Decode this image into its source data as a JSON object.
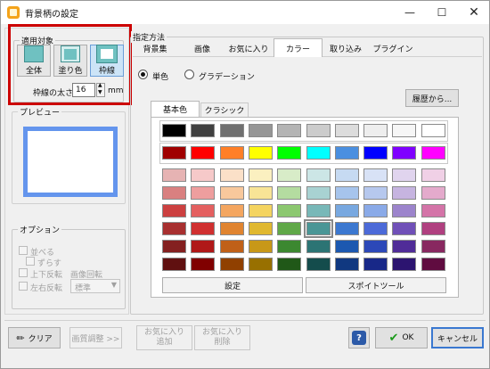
{
  "window": {
    "title": "背景柄の設定"
  },
  "target": {
    "legend": "適用対象",
    "buttons": [
      "全体",
      "塗り色",
      "枠線"
    ],
    "width_label": "枠線の太さ",
    "width_value": "16",
    "width_unit": "mm"
  },
  "preview": {
    "legend": "プレビュー"
  },
  "options": {
    "legend": "オプション",
    "tile": "並べる",
    "shift": "ずらす",
    "flip_v": "上下反転",
    "rotate_label": "画像回転",
    "flip_h": "左右反転",
    "rotate_value": "標準"
  },
  "method": {
    "legend": "指定方法",
    "tabs": [
      "背景集",
      "画像",
      "お気に入り",
      "カラー",
      "取り込み",
      "プラグイン"
    ],
    "active_tab": "カラー",
    "radio_solid": "単色",
    "radio_gradient": "グラデーション",
    "history_button": "履歴から...",
    "subtabs": [
      "基本色",
      "クラシック"
    ],
    "set_button": "設定",
    "eyedropper_button": "スポイトツール"
  },
  "palette": {
    "top_row": [
      "#000000",
      "#404040",
      "#707070",
      "#969696",
      "#b4b4b4",
      "#cccccc",
      "#dcdcdc",
      "#eeeeee",
      "#f6f6f6",
      "#ffffff"
    ],
    "primary_row": [
      "#a00000",
      "#ff0000",
      "#ff7f27",
      "#ffff00",
      "#00ff00",
      "#00ffff",
      "#4a8fe0",
      "#0000ff",
      "#7f00ff",
      "#ff00ff"
    ],
    "grid": [
      [
        "#e6b3b3",
        "#f6c9c9",
        "#fbe0c8",
        "#fbf0c0",
        "#d8ecc8",
        "#cce6e6",
        "#c6daf2",
        "#d8e2f6",
        "#e0d4ee",
        "#f0d0e6"
      ],
      [
        "#d98080",
        "#ee9e9e",
        "#f8c89c",
        "#f8e496",
        "#b4dca0",
        "#a8d2d2",
        "#a6c4ec",
        "#b6c8ee",
        "#c6b4e0",
        "#e4aacc"
      ],
      [
        "#cc4040",
        "#e46060",
        "#f4a660",
        "#f4d460",
        "#8cc870",
        "#78b8b8",
        "#78a8e0",
        "#8aaae8",
        "#9c84cc",
        "#d474a8"
      ],
      [
        "#a83030",
        "#d03030",
        "#e08430",
        "#e0b830",
        "#60a848",
        "#4a9696",
        "#3c78d0",
        "#4c6ad8",
        "#7050b8",
        "#b04080"
      ],
      [
        "#842020",
        "#b01818",
        "#c06018",
        "#c89818",
        "#3c8830",
        "#2c7474",
        "#1c58b0",
        "#2c48b8",
        "#502c98",
        "#882860"
      ],
      [
        "#601010",
        "#800000",
        "#904000",
        "#987000",
        "#205818",
        "#144c4c",
        "#103880",
        "#182888",
        "#2c1470",
        "#600c40"
      ]
    ],
    "selected": [
      3,
      5
    ]
  },
  "bottom": {
    "clear": "クリア",
    "adjust": "画質調整 >>",
    "fav_add": [
      "お気に入り",
      "追加"
    ],
    "fav_del": [
      "お気に入り",
      "削除"
    ],
    "ok": "OK",
    "cancel": "キャンセル"
  },
  "colors": {
    "accent": "#cc0000",
    "preview_border": "#6495ed"
  }
}
